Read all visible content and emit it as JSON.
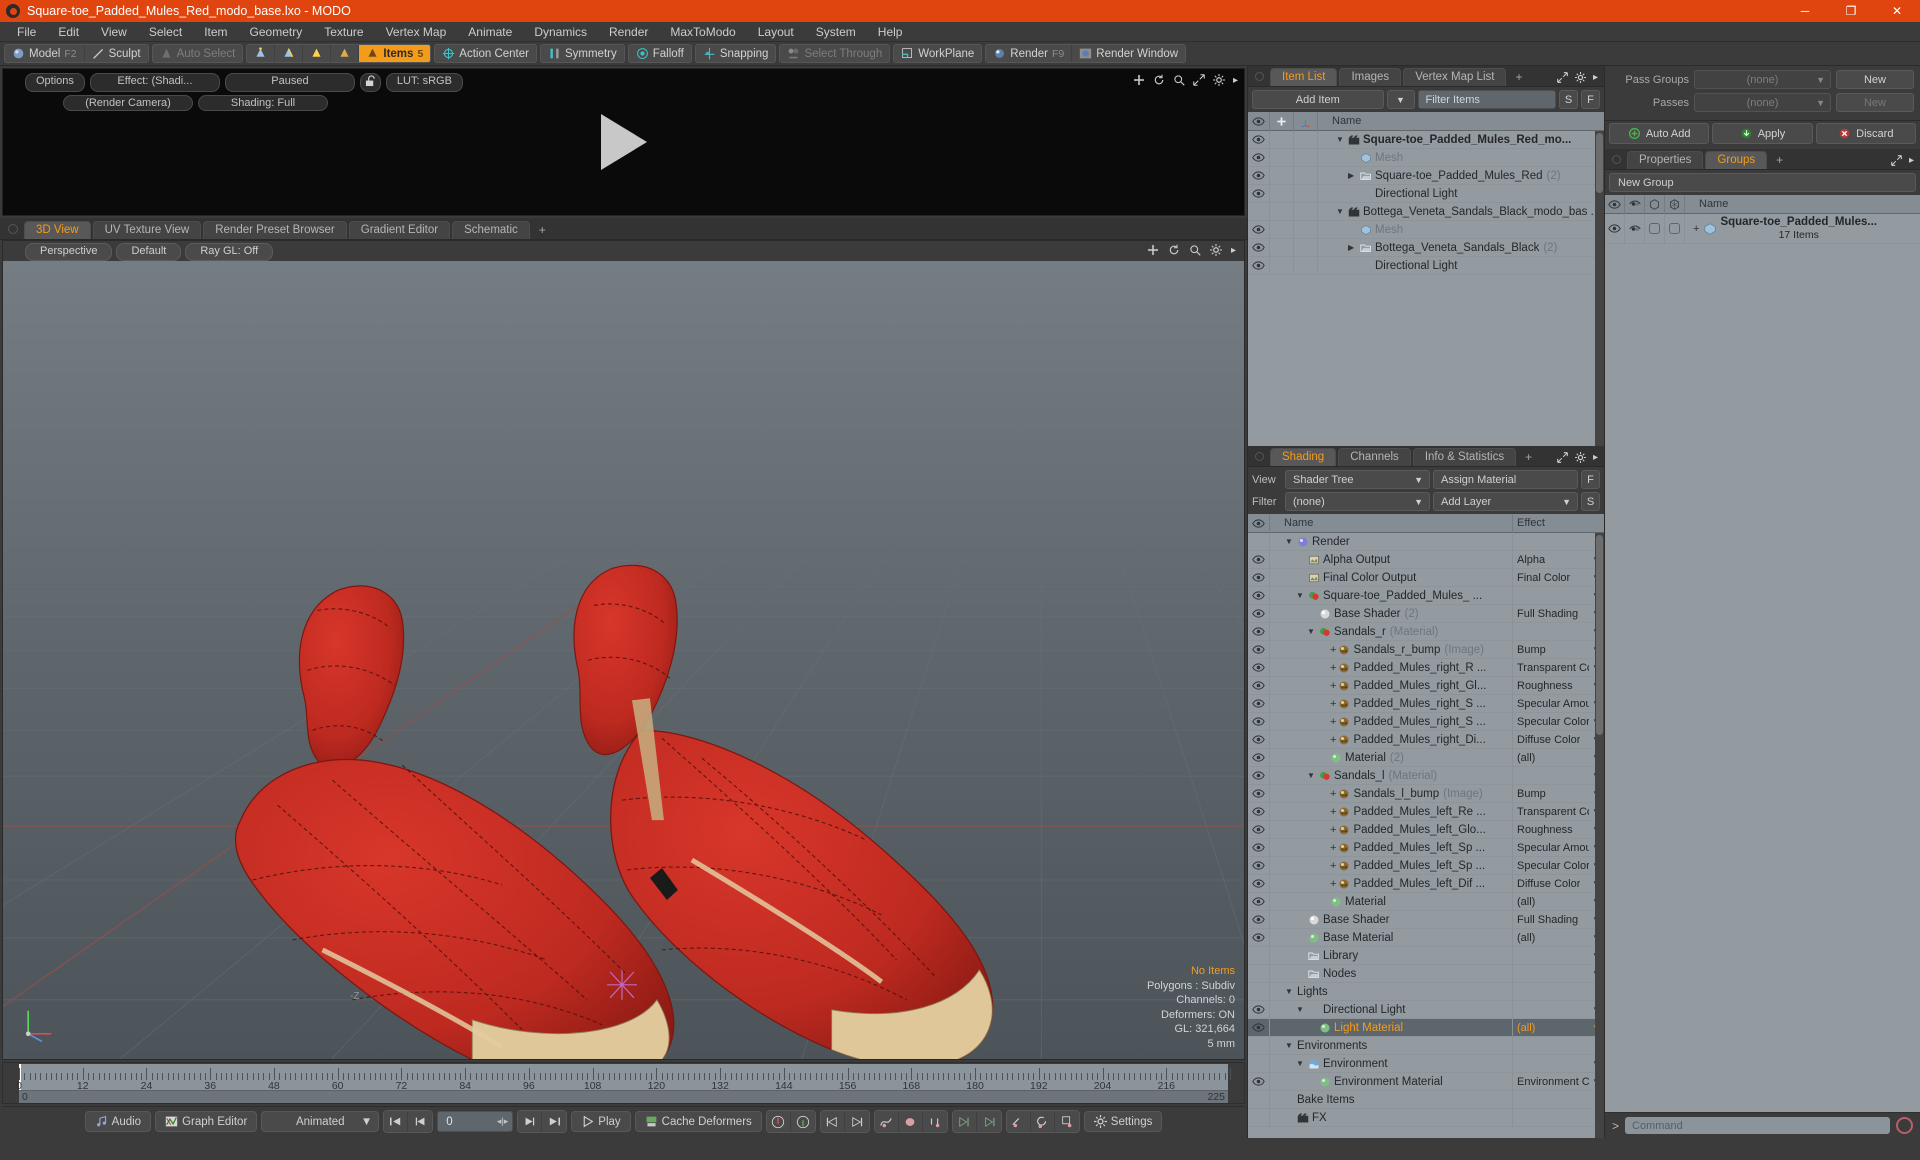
{
  "window": {
    "title": "Square-toe_Padded_Mules_Red_modo_base.lxo - MODO",
    "minimize": "─",
    "maximize": "❐",
    "close": "✕"
  },
  "menu": [
    "File",
    "Edit",
    "View",
    "Select",
    "Item",
    "Geometry",
    "Texture",
    "Vertex Map",
    "Animate",
    "Dynamics",
    "Render",
    "MaxToModo",
    "Layout",
    "System",
    "Help"
  ],
  "modebar": {
    "model": "Model",
    "model_hint": "F2",
    "sculpt": "Sculpt",
    "auto_select": "Auto Select",
    "items": "Items",
    "items_hint": "5",
    "action_center": "Action Center",
    "symmetry": "Symmetry",
    "falloff": "Falloff",
    "snapping": "Snapping",
    "select_through": "Select Through",
    "workplane": "WorkPlane",
    "render": "Render",
    "render_hint": "F9",
    "render_window": "Render Window"
  },
  "preview": {
    "options": "Options",
    "effect": "Effect: (Shadi...",
    "paused": "Paused",
    "lut": "LUT: sRGB",
    "camera": "(Render Camera)",
    "shading": "Shading: Full"
  },
  "viewport": {
    "tabs": [
      {
        "label": "3D View",
        "active": true
      },
      {
        "label": "UV Texture View",
        "active": false
      },
      {
        "label": "Render Preset Browser",
        "active": false
      },
      {
        "label": "Gradient Editor",
        "active": false
      },
      {
        "label": "Schematic",
        "active": false
      }
    ],
    "tab_plus": "+",
    "controls": [
      "Perspective",
      "Default",
      "Ray GL: Off"
    ],
    "axis_label_z": "-Z",
    "stats": {
      "selection": "No Items",
      "polygons": "Polygons : Subdiv",
      "channels": "Channels: 0",
      "deformers": "Deformers: ON",
      "gl": "GL: 321,664",
      "units": "5 mm"
    }
  },
  "timeline": {
    "ticks": [
      0,
      12,
      24,
      36,
      48,
      60,
      72,
      84,
      96,
      108,
      120,
      132,
      144,
      156,
      168,
      180,
      192,
      204,
      216
    ],
    "range_start": "0",
    "range_end": "225",
    "end_label": "225"
  },
  "transport": {
    "audio": "Audio",
    "graph_editor": "Graph Editor",
    "mode": "Animated",
    "frame": "0",
    "play": "Play",
    "cache_deformers": "Cache Deformers",
    "settings": "Settings"
  },
  "item_list": {
    "tabs": [
      {
        "label": "Item List",
        "active": true
      },
      {
        "label": "Images",
        "active": false
      },
      {
        "label": "Vertex Map List",
        "active": false
      }
    ],
    "tab_plus": "+",
    "add_item": "Add Item",
    "filter_placeholder": "Filter Items",
    "btn_s": "S",
    "btn_f": "F",
    "col_name": "Name",
    "rows": [
      {
        "name": "Square-toe_Padded_Mules_Red_mo...",
        "icon": "scene-icon",
        "indent": 1,
        "bold": true,
        "eye": true,
        "twirl": "down"
      },
      {
        "name": "Mesh",
        "icon": "mesh-icon",
        "indent": 2,
        "dim": true,
        "eye": true,
        "twirl": "none"
      },
      {
        "name": "Square-toe_Padded_Mules_Red",
        "count": "(2)",
        "icon": "group-icon",
        "indent": 2,
        "eye": true,
        "twirl": "right"
      },
      {
        "name": "Directional Light",
        "icon": "light-icon",
        "indent": 2,
        "eye": true,
        "twirl": "none"
      },
      {
        "name": "Bottega_Veneta_Sandals_Black_modo_bas ...",
        "icon": "scene-icon",
        "indent": 1,
        "eye": false,
        "twirl": "down"
      },
      {
        "name": "Mesh",
        "icon": "mesh-icon",
        "indent": 2,
        "dim": true,
        "eye": true,
        "twirl": "none"
      },
      {
        "name": "Bottega_Veneta_Sandals_Black",
        "count": "(2)",
        "icon": "group-icon",
        "indent": 2,
        "eye": true,
        "twirl": "right"
      },
      {
        "name": "Directional Light",
        "icon": "light-icon",
        "indent": 2,
        "eye": true,
        "twirl": "none"
      }
    ]
  },
  "shading": {
    "tabs": [
      {
        "label": "Shading",
        "active": true
      },
      {
        "label": "Channels",
        "active": false
      },
      {
        "label": "Info & Statistics",
        "active": false
      }
    ],
    "tab_plus": "+",
    "view_label": "View",
    "view_value": "Shader Tree",
    "assign_material": "Assign Material",
    "btn_f": "F",
    "filter_label": "Filter",
    "filter_value": "(none)",
    "add_layer": "Add Layer",
    "btn_s": "S",
    "col_name": "Name",
    "col_effect": "Effect",
    "rows": [
      {
        "name": "Render",
        "icon": "render-icon",
        "indent": 1,
        "effect": "",
        "eye": false,
        "twirl": "down"
      },
      {
        "name": "Alpha Output",
        "icon": "output-icon",
        "indent": 2,
        "effect": "Alpha",
        "eye": true
      },
      {
        "name": "Final Color Output",
        "icon": "output-icon",
        "indent": 2,
        "effect": "Final Color",
        "eye": true
      },
      {
        "name": "Square-toe_Padded_Mules_ ...",
        "icon": "material-icon",
        "indent": 2,
        "effect": "",
        "eye": true,
        "twirl": "down"
      },
      {
        "name": "Base Shader",
        "count": "(2)",
        "icon": "shader-icon",
        "indent": 3,
        "effect": "Full Shading",
        "eye": true
      },
      {
        "name": "Sandals_r",
        "count": "(Material)",
        "icon": "material-icon",
        "indent": 3,
        "effect": "",
        "eye": true,
        "twirl": "down"
      },
      {
        "name": "Sandals_r_bump",
        "count": "(Image)",
        "icon": "image-icon",
        "indent": 4,
        "effect": "Bump",
        "eye": true,
        "plus": true
      },
      {
        "name": "Padded_Mules_right_R ...",
        "icon": "image-icon",
        "indent": 4,
        "effect": "Transparent Color",
        "eye": true,
        "plus": true
      },
      {
        "name": "Padded_Mules_right_Gl...",
        "icon": "image-icon",
        "indent": 4,
        "effect": "Roughness",
        "eye": true,
        "plus": true
      },
      {
        "name": "Padded_Mules_right_S ...",
        "icon": "image-icon",
        "indent": 4,
        "effect": "Specular Amount",
        "eye": true,
        "plus": true
      },
      {
        "name": "Padded_Mules_right_S ...",
        "icon": "image-icon",
        "indent": 4,
        "effect": "Specular Color",
        "eye": true,
        "plus": true
      },
      {
        "name": "Padded_Mules_right_Di...",
        "icon": "image-icon",
        "indent": 4,
        "effect": "Diffuse Color",
        "eye": true,
        "plus": true
      },
      {
        "name": "Material",
        "count": "(2)",
        "icon": "basematerial-icon",
        "indent": 4,
        "effect": "(all)",
        "eye": true
      },
      {
        "name": "Sandals_l",
        "count": "(Material)",
        "icon": "material-icon",
        "indent": 3,
        "effect": "",
        "eye": true,
        "twirl": "down"
      },
      {
        "name": "Sandals_l_bump",
        "count": "(Image)",
        "icon": "image-icon",
        "indent": 4,
        "effect": "Bump",
        "eye": true,
        "plus": true
      },
      {
        "name": "Padded_Mules_left_Re ...",
        "icon": "image-icon",
        "indent": 4,
        "effect": "Transparent Color",
        "eye": true,
        "plus": true
      },
      {
        "name": "Padded_Mules_left_Glo...",
        "icon": "image-icon",
        "indent": 4,
        "effect": "Roughness",
        "eye": true,
        "plus": true
      },
      {
        "name": "Padded_Mules_left_Sp ...",
        "icon": "image-icon",
        "indent": 4,
        "effect": "Specular Amount",
        "eye": true,
        "plus": true
      },
      {
        "name": "Padded_Mules_left_Sp ...",
        "icon": "image-icon",
        "indent": 4,
        "effect": "Specular Color",
        "eye": true,
        "plus": true
      },
      {
        "name": "Padded_Mules_left_Dif ...",
        "icon": "image-icon",
        "indent": 4,
        "effect": "Diffuse Color",
        "eye": true,
        "plus": true
      },
      {
        "name": "Material",
        "icon": "basematerial-icon",
        "indent": 4,
        "effect": "(all)",
        "eye": true
      },
      {
        "name": "Base Shader",
        "icon": "shader-icon",
        "indent": 2,
        "effect": "Full Shading",
        "eye": true
      },
      {
        "name": "Base Material",
        "icon": "basematerial-icon",
        "indent": 2,
        "effect": "(all)",
        "eye": true
      },
      {
        "name": "Library",
        "icon": "group-icon",
        "indent": 2,
        "effect": "",
        "eye": false
      },
      {
        "name": "Nodes",
        "icon": "group-icon",
        "indent": 2,
        "effect": "",
        "eye": false
      },
      {
        "name": "Lights",
        "icon": "none",
        "indent": 1,
        "effect": "",
        "eye": false,
        "twirl": "down"
      },
      {
        "name": "Directional Light",
        "icon": "light-icon",
        "indent": 2,
        "effect": "",
        "eye": true,
        "twirl": "down"
      },
      {
        "name": "Light Material",
        "icon": "basematerial-icon",
        "indent": 3,
        "effect": "(all)",
        "eye": true,
        "selected": true
      },
      {
        "name": "Environments",
        "icon": "none",
        "indent": 1,
        "effect": "",
        "eye": false,
        "twirl": "down"
      },
      {
        "name": "Environment",
        "icon": "env-icon",
        "indent": 2,
        "effect": "",
        "eye": false,
        "twirl": "down"
      },
      {
        "name": "Environment Material",
        "icon": "basematerial-icon",
        "indent": 3,
        "effect": "Environment Color",
        "eye": true
      },
      {
        "name": "Bake Items",
        "icon": "none",
        "indent": 1,
        "effect": "",
        "eye": false
      },
      {
        "name": "FX",
        "icon": "scene-icon",
        "indent": 1,
        "effect": "",
        "eye": false
      }
    ]
  },
  "passes": {
    "pass_groups_label": "Pass Groups",
    "pass_groups_value": "(none)",
    "pass_groups_new": "New",
    "passes_label": "Passes",
    "passes_value": "(none)",
    "passes_new": "New",
    "auto_add": "Auto Add",
    "apply": "Apply",
    "discard": "Discard"
  },
  "groups": {
    "tabs": [
      {
        "label": "Properties",
        "active": false
      },
      {
        "label": "Groups",
        "active": true
      }
    ],
    "tab_plus": "+",
    "new_group": "New Group",
    "col_name": "Name",
    "rows": [
      {
        "name": "Square-toe_Padded_Mules...",
        "sub": "17 Items"
      }
    ]
  },
  "command": {
    "prompt": ">",
    "placeholder": "Command"
  },
  "colors": {
    "title_bar": "#e1450f",
    "accent": "#f59b1c",
    "panel_bg": "#3b3b3b",
    "tree_bg": "#939ba1",
    "viewport_bg": "#5c646b",
    "shoe_red": "#c0281f"
  }
}
